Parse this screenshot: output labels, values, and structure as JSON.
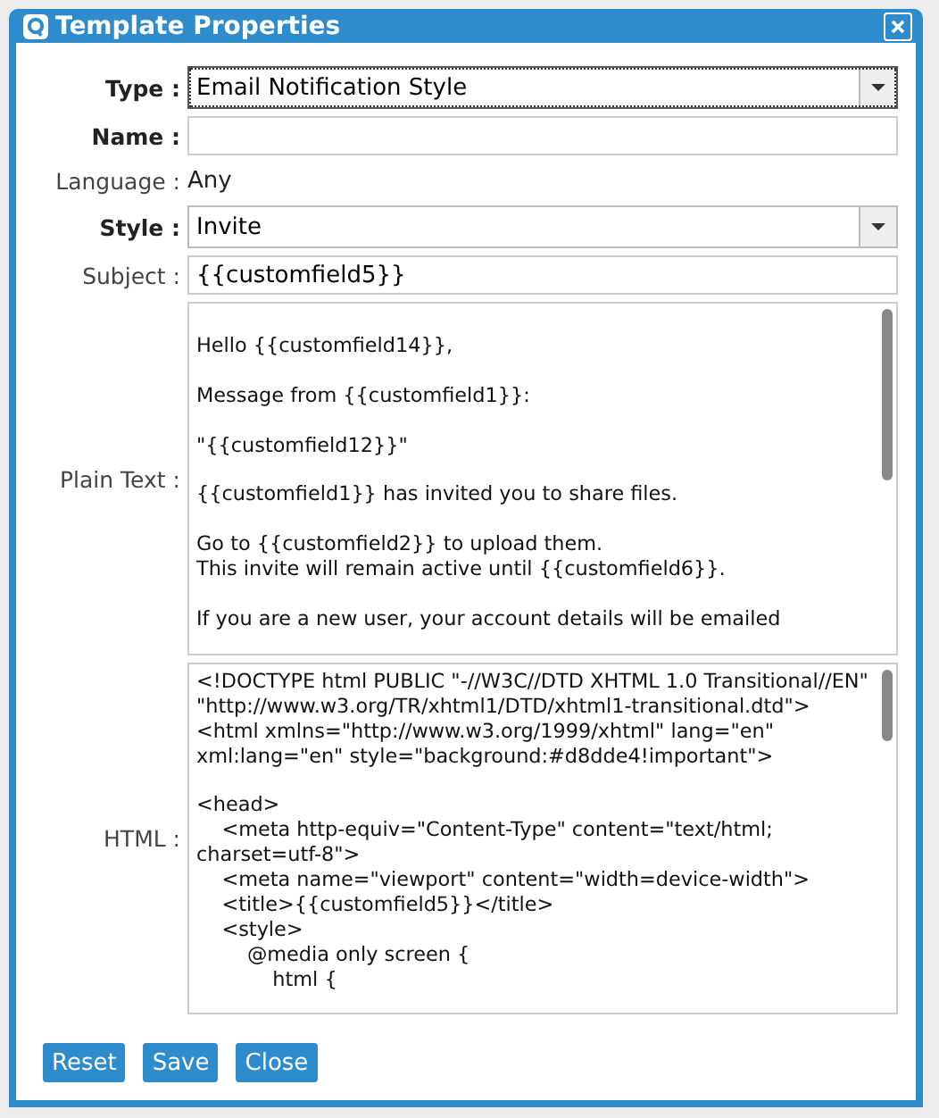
{
  "window": {
    "title": "Template Properties"
  },
  "fields": [
    {
      "kind": "select",
      "label": "Type :",
      "bold": true,
      "value": "Email Notification Style",
      "focused": true
    },
    {
      "kind": "input",
      "label": "Name :",
      "bold": true
    },
    {
      "kind": "static",
      "label": "Language :",
      "bold": false,
      "value": "Any"
    },
    {
      "kind": "select",
      "label": "Style :",
      "bold": true,
      "value": "Invite",
      "focused": false
    },
    {
      "kind": "input",
      "label": "Subject :",
      "bold": false,
      "value": "{{customfield5}}"
    },
    {
      "kind": "textarea",
      "label": "Plain Text :",
      "bold": false,
      "paragraphs": [
        [
          "Hello {{customfield14}},"
        ],
        [
          "Message from {{customfield1}}:"
        ],
        [
          "\"{{customfield12}}\""
        ],
        [
          "{{customfield1}} has invited you to share files."
        ],
        [
          "Go to {{customfield2}} to upload them.",
          "This invite will remain active until {{customfield6}}."
        ],
        [
          "If you are a new user, your account details will be emailed"
        ]
      ]
    },
    {
      "kind": "textarea",
      "label": "HTML :",
      "bold": false,
      "paragraphs": [
        [
          "<!DOCTYPE html PUBLIC \"-//W3C//DTD XHTML 1.0 Transitional//EN\"",
          "\"http://www.w3.org/TR/xhtml1/DTD/xhtml1-transitional.dtd\">",
          "<html xmlns=\"http://www.w3.org/1999/xhtml\" lang=\"en\"",
          "xml:lang=\"en\" style=\"background:#d8dde4!important\">"
        ],
        [
          "<head>",
          "    <meta http-equiv=\"Content-Type\" content=\"text/html;",
          "charset=utf-8\">",
          "    <meta name=\"viewport\" content=\"width=device-width\">",
          "    <title>{{customfield5}}</title>",
          "    <style>",
          "        @media only screen {",
          "            html {"
        ]
      ]
    }
  ],
  "buttons": [
    "Reset",
    "Save",
    "Close"
  ]
}
